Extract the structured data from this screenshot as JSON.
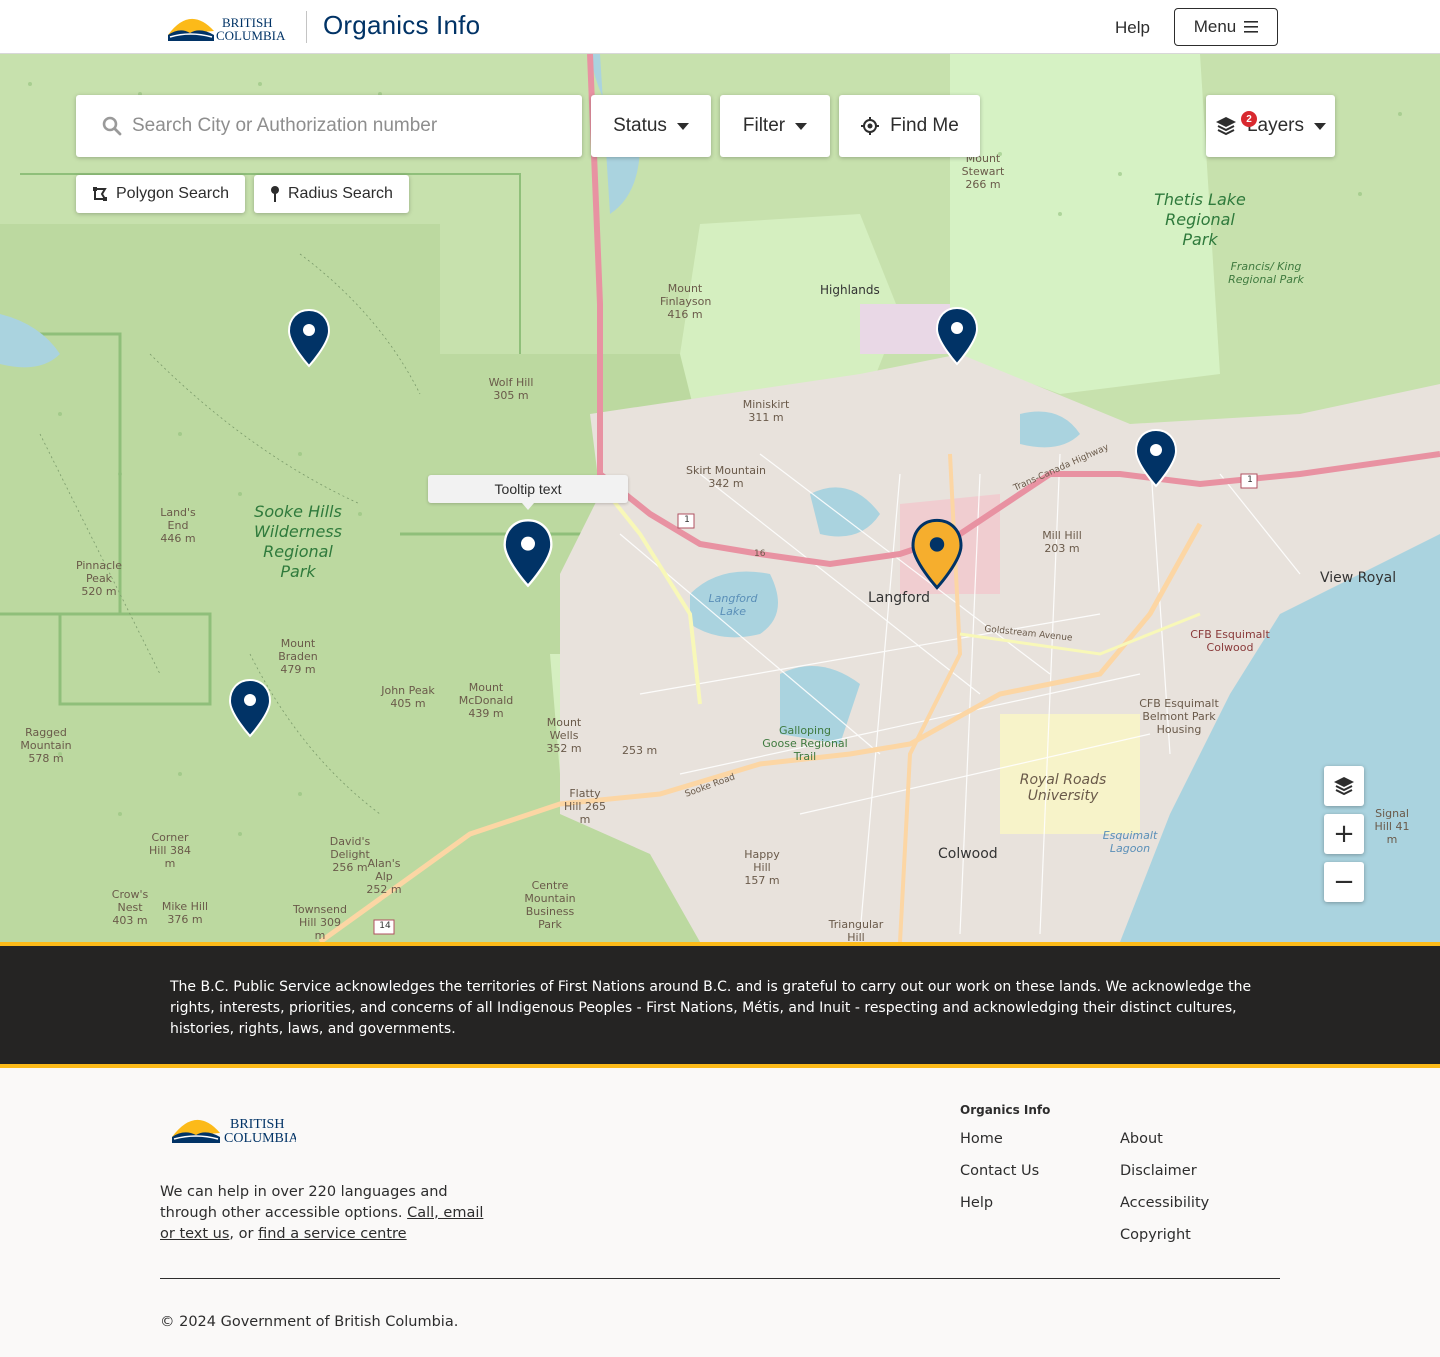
{
  "header": {
    "logo_text_line1": "BRITISH",
    "logo_text_line2": "COLUMBIA",
    "app_title": "Organics Info",
    "help_label": "Help",
    "menu_label": "Menu"
  },
  "map_controls": {
    "search_placeholder": "Search City or Authorization number",
    "status_label": "Status",
    "filter_label": "Filter",
    "find_me_label": "Find Me",
    "layers_label": "Layers",
    "layers_badge": "2",
    "polygon_search_label": "Polygon Search",
    "radius_search_label": "Radius Search",
    "tooltip_text": "Tooltip text",
    "zoom_in": "+",
    "zoom_out": "−"
  },
  "map_labels": {
    "mount_stewart": "Mount Stewart 266 m",
    "thetis_lake": "Thetis Lake Regional Park",
    "francis_king": "Francis/ King Regional Park",
    "highlands": "Highlands",
    "mount_finlayson": "Mount Finlayson 416 m",
    "wolf_hill": "Wolf Hill 305 m",
    "miniskirt": "Miniskirt 311 m",
    "skirt_mountain": "Skirt Mountain 342 m",
    "lands_end": "Land's End 446 m",
    "sooke_hills": "Sooke Hills Wilderness Regional Park",
    "pinnacle_peak": "Pinnacle Peak 520 m",
    "mount_braden": "Mount Braden 479 m",
    "john_peak": "John Peak 405 m",
    "mount_mcdonald": "Mount McDonald 439 m",
    "ragged_mountain": "Ragged Mountain 578 m",
    "mount_wells": "Mount Wells 352 m",
    "hill_253": "253 m",
    "flatty_hill": "Flatty Hill 265 m",
    "langford_lake": "Langford Lake",
    "langford": "Langford",
    "mill_hill": "Mill Hill 203 m",
    "view_royal": "View Royal",
    "cfb_colwood": "CFB Esquimalt Colwood",
    "cfb_belmont": "CFB Esquimalt Belmont Park Housing",
    "galloping_goose": "Galloping Goose Regional Trail",
    "royal_roads": "Royal Roads University",
    "esquimalt_lagoon": "Esquimalt Lagoon",
    "colwood": "Colwood",
    "happy_hill": "Happy Hill 157 m",
    "corner_hill": "Corner Hill 384 m",
    "davids_delight": "David's Delight 256 m",
    "alans_alp": "Alan's Alp 252 m",
    "crows_nest": "Crow's Nest 403 m",
    "mike_hill": "Mike Hill 376 m",
    "townsend_hill": "Townsend Hill 309 m",
    "centre_mountain": "Centre Mountain Business Park",
    "triangular_hill": "Triangular Hill",
    "signal_hill": "Signal Hill 41 m",
    "goldstream_avenue": "Goldstream Avenue",
    "trans_canada": "Trans-Canada Highway",
    "sooke_road": "Sooke Road",
    "route_1": "1",
    "route_14": "14",
    "route_16": "16"
  },
  "acknowledgement": "The B.C. Public Service acknowledges the territories of First Nations around B.C. and is grateful to carry out our work on these lands. We acknowledge the rights, interests, priorities, and concerns of all Indigenous Peoples - First Nations, Métis, and Inuit - respecting and acknowledging their distinct cultures, histories, rights, laws, and governments.",
  "footer": {
    "help_text_1": "We can help in over 220 languages and through other accessible options.",
    "help_link_1": "Call, email or text us",
    "help_text_2": ", or",
    "help_link_2": "find a service centre",
    "section_heading": "Organics Info",
    "links_col1": [
      "Home",
      "Contact Us",
      "Help"
    ],
    "links_col2": [
      "About",
      "Disclaimer",
      "Accessibility",
      "Copyright"
    ],
    "copyright": "© 2024 Government of British Columbia."
  },
  "colors": {
    "bc_blue": "#013366",
    "bc_gold": "#fcba19",
    "marker_blue": "#013366",
    "marker_gold": "#f6ae2d",
    "ack_background": "#252423"
  }
}
